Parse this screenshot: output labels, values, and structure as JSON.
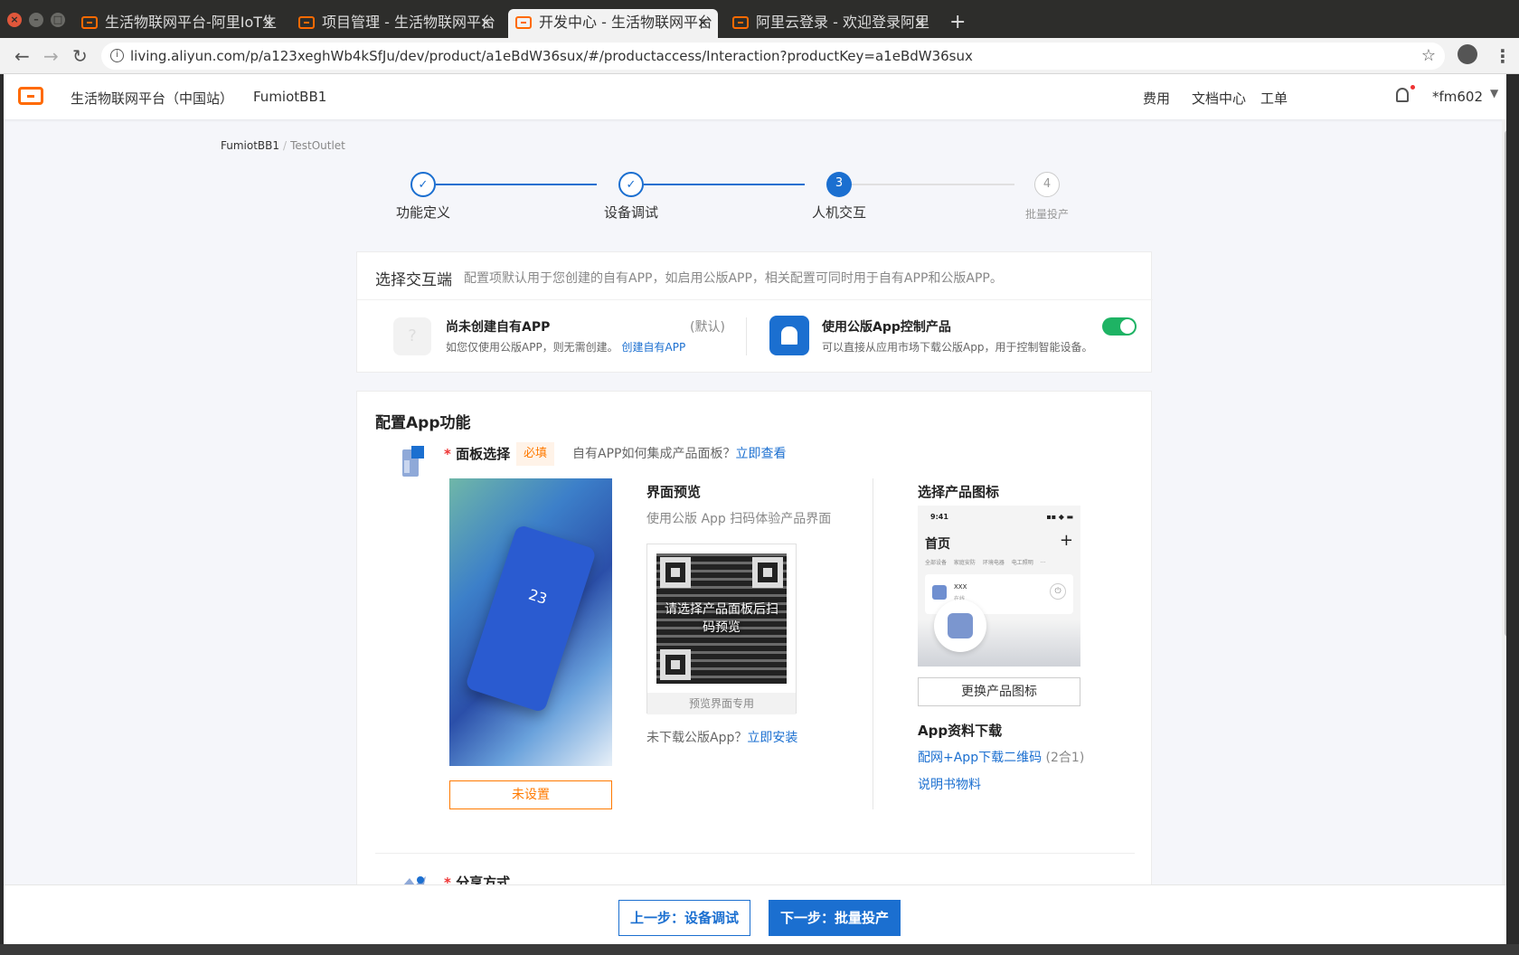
{
  "browser": {
    "tabs": [
      {
        "title": "生活物联网平台-阿里IoT生"
      },
      {
        "title": "项目管理 - 生活物联网平台"
      },
      {
        "title": "开发中心 - 生活物联网平台",
        "active": true
      },
      {
        "title": "阿里云登录 - 欢迎登录阿里"
      }
    ],
    "url": "living.aliyun.com/p/a123xeghWb4kSfJu/dev/product/a1eBdW36sux/#/productaccess/Interaction?productKey=a1eBdW36sux"
  },
  "topnav": {
    "platform": "生活物联网平台（中国站）",
    "project": "FumiotBB1",
    "fee": "费用",
    "docs": "文档中心",
    "ticket": "工单",
    "user": "*fm602"
  },
  "breadcrumb": {
    "item1": "FumiotBB1",
    "item2": "TestOutlet"
  },
  "steps": [
    {
      "label": "功能定义",
      "state": "done",
      "num": "✓"
    },
    {
      "label": "设备调试",
      "state": "done",
      "num": "✓"
    },
    {
      "label": "人机交互",
      "state": "current",
      "num": "3"
    },
    {
      "label": "批量投产",
      "state": "todo",
      "num": "4"
    }
  ],
  "interaction": {
    "title": "选择交互端",
    "desc": "配置项默认用于您创建的自有APP，如启用公版APP，相关配置可同时用于自有APP和公版APP。",
    "own_app": {
      "title": "尚未创建自有APP",
      "tag": "(默认)",
      "desc": "如您仅使用公版APP，则无需创建。",
      "link": "创建自有APP",
      "icon_glyph": "?"
    },
    "public_app": {
      "title": "使用公版App控制产品",
      "desc": "可以直接从应用市场下载公版App，用于控制智能设备。",
      "enabled": true
    }
  },
  "config": {
    "title": "配置App功能",
    "panel": {
      "required_mark": "*",
      "label": "面板选择",
      "badge": "必填",
      "hint": "自有APP如何集成产品面板？",
      "hint_link": "立即查看",
      "phone_temp": "23",
      "unset_button": "未设置"
    },
    "preview": {
      "title": "界面预览",
      "desc": "使用公版 App 扫码体验产品界面",
      "qr_overlay": "请选择产品面板后扫码预览",
      "qr_footer": "预览界面专用",
      "download_text": "未下载公版App？",
      "download_link": "立即安装"
    },
    "icon": {
      "title": "选择产品图标",
      "mock_time": "9:41",
      "mock_signal": "▪▪ ◆ ▬",
      "mock_home": "首页",
      "mock_plus": "+",
      "mock_tabs": "全部设备 家庭安防 环境电器 电工照明 ···",
      "mock_device": "XXX",
      "mock_status": "在线",
      "mock_power": "⏻",
      "change_button": "更换产品图标"
    },
    "download": {
      "title": "App资料下载",
      "link1": "配网+App下载二维码",
      "link1_suffix": "(2合1)",
      "link2": "说明书物料"
    },
    "share": {
      "required_mark": "*",
      "label": "分享方式"
    }
  },
  "footer": {
    "prev_button": "上一步：设备调试",
    "next_button": "下一步：批量投产"
  },
  "colors": {
    "primary": "#1b6fd0",
    "brand": "#ff6a00",
    "toggle_on": "#1eb364",
    "required": "#ff7a00"
  }
}
